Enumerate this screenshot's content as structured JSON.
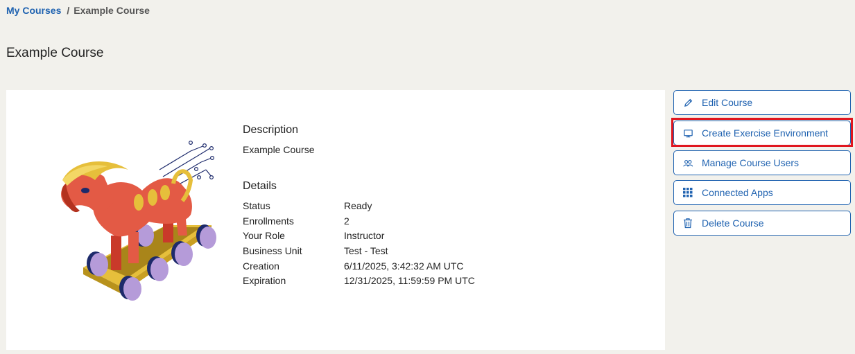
{
  "breadcrumb": {
    "root": "My Courses",
    "separator": "/",
    "current": "Example Course"
  },
  "page": {
    "title": "Example Course"
  },
  "course": {
    "description_heading": "Description",
    "description": "Example Course",
    "details_heading": "Details",
    "details": [
      {
        "label": "Status",
        "value": "Ready"
      },
      {
        "label": "Enrollments",
        "value": "2"
      },
      {
        "label": "Your Role",
        "value": "Instructor"
      },
      {
        "label": "Business Unit",
        "value": "Test - Test"
      },
      {
        "label": "Creation",
        "value": "6/11/2025, 3:42:32 AM UTC"
      },
      {
        "label": "Expiration",
        "value": "12/31/2025, 11:59:59 PM UTC"
      }
    ]
  },
  "actions": [
    {
      "label": "Edit Course",
      "icon": "pencil-icon"
    },
    {
      "label": "Create Exercise Environment",
      "icon": "monitor-icon"
    },
    {
      "label": "Manage Course Users",
      "icon": "users-icon"
    },
    {
      "label": "Connected Apps",
      "icon": "grid-icon"
    },
    {
      "label": "Delete Course",
      "icon": "trash-icon"
    }
  ],
  "colors": {
    "accent": "#1f62b0",
    "highlight": "#e0161f",
    "background": "#f2f1ec"
  }
}
